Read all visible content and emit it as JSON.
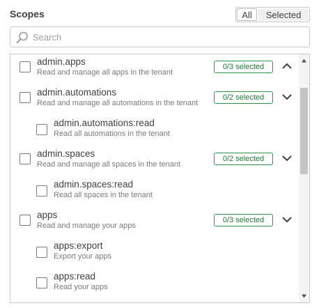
{
  "header": {
    "title": "Scopes"
  },
  "filter": {
    "all_label": "All",
    "selected_label": "Selected",
    "active": "All"
  },
  "search": {
    "placeholder": "Search",
    "value": ""
  },
  "scopes": [
    {
      "name": "admin.apps",
      "description": "Read and manage all apps in the tenant",
      "badge": "0/3 selected",
      "expanded": true,
      "checked": false
    },
    {
      "name": "admin.automations",
      "description": "Read and manage all automations in the tenant",
      "badge": "0/2 selected",
      "expanded": false,
      "checked": false
    },
    {
      "name": "admin.automations:read",
      "description": "Read all automations in the tenant",
      "checked": false
    },
    {
      "name": "admin.spaces",
      "description": "Read and manage all spaces in the tenant",
      "badge": "0/2 selected",
      "expanded": false,
      "checked": false
    },
    {
      "name": "admin.spaces:read",
      "description": "Read all spaces in the tenant",
      "checked": false
    },
    {
      "name": "apps",
      "description": "Read and manage your apps",
      "badge": "0/3 selected",
      "expanded": false,
      "checked": false
    },
    {
      "name": "apps:export",
      "description": "Export your apps",
      "checked": false
    },
    {
      "name": "apps:read",
      "description": "Read your apps",
      "checked": false
    }
  ],
  "colors": {
    "badge_border": "#2b9a4d",
    "badge_text": "#1d7a3a",
    "text": "#404040",
    "muted": "#7a7a7a",
    "border": "#c8c8c8"
  },
  "icons": {
    "search": "magnifier-icon",
    "collapse": "chevron-up-icon",
    "expand": "chevron-down-icon"
  }
}
